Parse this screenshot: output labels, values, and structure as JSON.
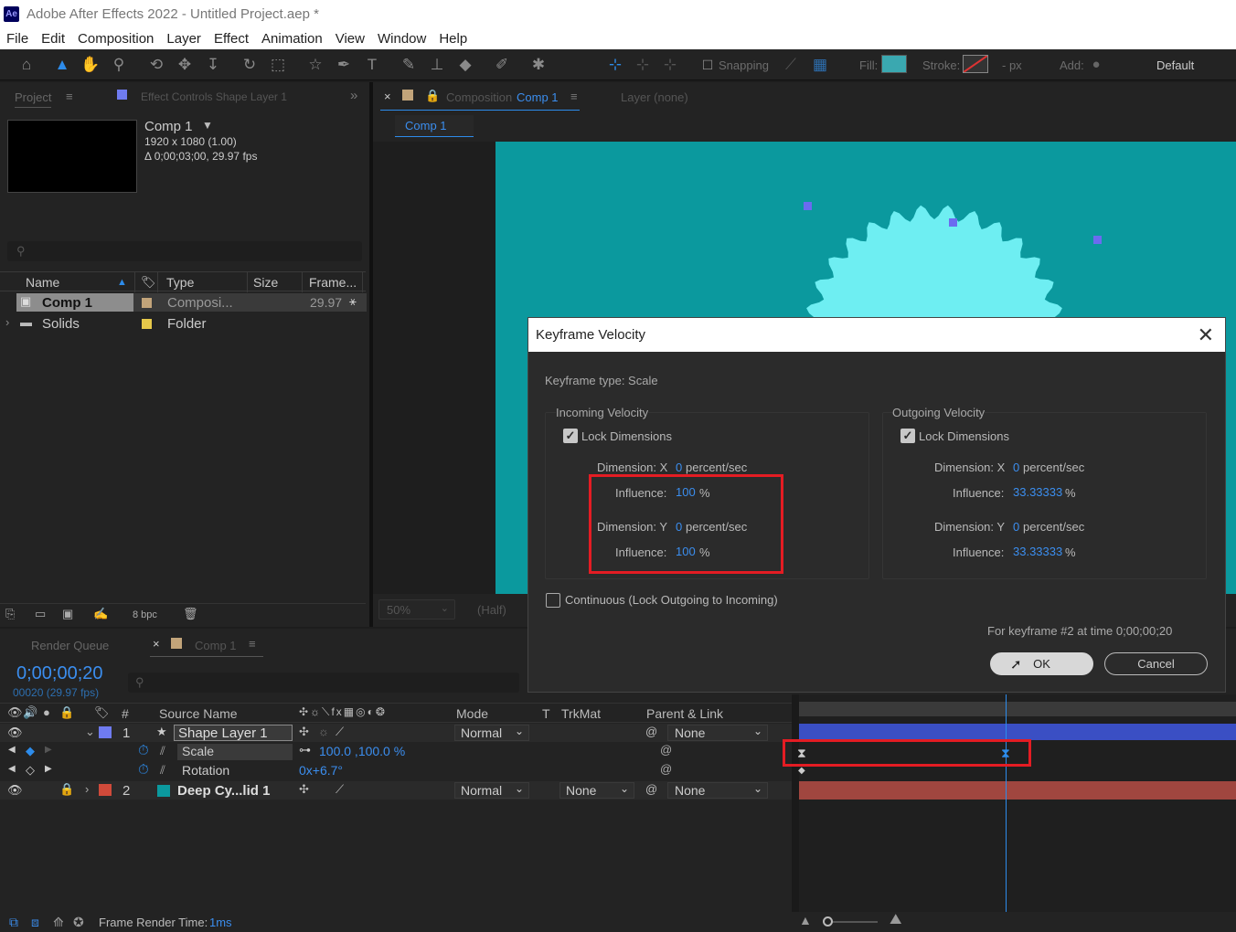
{
  "window": {
    "title": "Adobe After Effects 2022 - Untitled Project.aep *",
    "logo": "Ae"
  },
  "menu": [
    "File",
    "Edit",
    "Composition",
    "Layer",
    "Effect",
    "Animation",
    "View",
    "Window",
    "Help"
  ],
  "toolbar": {
    "snapping": "Snapping",
    "fill": "Fill:",
    "stroke": "Stroke:",
    "stroke_px": "- px",
    "add": "Add:",
    "workspace": "Default",
    "fill_color": "#3aa8b0"
  },
  "project_panel": {
    "tab_project": "Project",
    "tab_effect_controls": "Effect Controls Shape Layer 1",
    "comp_name": "Comp 1",
    "comp_res": "1920 x 1080 (1.00)",
    "comp_duration": "Δ 0;00;03;00, 29.97 fps",
    "columns": {
      "name": "Name",
      "type": "Type",
      "size": "Size",
      "frame": "Frame..."
    },
    "items": [
      {
        "name": "Comp 1",
        "type": "Composi...",
        "frame": "29.97",
        "color": "#c2a47a"
      },
      {
        "name": "Solids",
        "type": "Folder",
        "frame": "",
        "color": "#e6c84a"
      }
    ],
    "bpc": "8 bpc"
  },
  "comp_panel": {
    "tab_composition": "Composition",
    "tab_comp_name": "Comp 1",
    "tab_layer": "Layer (none)",
    "subtab": "Comp 1",
    "zoom": "50%",
    "resolution": "(Half)",
    "canvas_color": "#0b999e",
    "shape_color": "#6eeef2"
  },
  "dialog": {
    "title": "Keyframe Velocity",
    "keyframe_type": "Keyframe type: Scale",
    "incoming": {
      "heading": "Incoming Velocity",
      "lock": "Lock Dimensions",
      "dim_x_label": "Dimension: X",
      "dim_x_val": "0",
      "dim_x_unit": "percent/sec",
      "infl_x_label": "Influence:",
      "infl_x_val": "100",
      "infl_x_unit": "%",
      "dim_y_label": "Dimension: Y",
      "dim_y_val": "0",
      "dim_y_unit": "percent/sec",
      "infl_y_label": "Influence:",
      "infl_y_val": "100",
      "infl_y_unit": "%"
    },
    "outgoing": {
      "heading": "Outgoing Velocity",
      "lock": "Lock Dimensions",
      "dim_x_label": "Dimension: X",
      "dim_x_val": "0",
      "dim_x_unit": "percent/sec",
      "infl_x_label": "Influence:",
      "infl_x_val": "33.33333",
      "infl_x_unit": "%",
      "dim_y_label": "Dimension: Y",
      "dim_y_val": "0",
      "dim_y_unit": "percent/sec",
      "infl_y_label": "Influence:",
      "infl_y_val": "33.33333",
      "infl_y_unit": "%"
    },
    "continuous": "Continuous (Lock Outgoing to Incoming)",
    "footer": "For keyframe #2 at time 0;00;00;20",
    "ok": "OK",
    "cancel": "Cancel"
  },
  "timeline": {
    "tab_render_queue": "Render Queue",
    "tab_comp": "Comp 1",
    "timecode": "0;00;00;20",
    "frame_info": "00020 (29.97 fps)",
    "columns": {
      "num": "#",
      "source": "Source Name",
      "mode": "Mode",
      "t": "T",
      "trkmat": "TrkMat",
      "parent": "Parent & Link"
    },
    "layers": [
      {
        "num": "1",
        "name": "Shape Layer 1",
        "mode": "Normal",
        "trkmat": "",
        "parent": "None",
        "label_color": "#6f7bf0",
        "bar_color": "#3a4fc4"
      },
      {
        "num": "2",
        "name": "Deep Cy...lid 1",
        "mode": "Normal",
        "trkmat": "None",
        "parent": "None",
        "label_color": "#d04a3a",
        "bar_color": "#a0463f"
      }
    ],
    "props": [
      {
        "name": "Scale",
        "value": "100.0 ,100.0 %"
      },
      {
        "name": "Rotation",
        "value": "0x+6.7°"
      }
    ]
  },
  "status": {
    "label": "Frame Render Time:",
    "value": "1ms"
  }
}
